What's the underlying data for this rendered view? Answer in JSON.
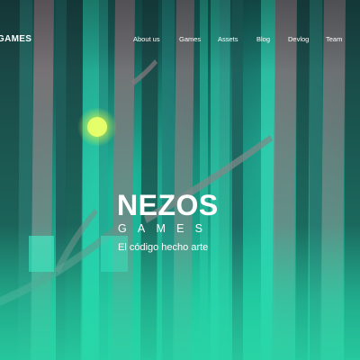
{
  "header": {
    "brand": "S GAMES",
    "nav": [
      {
        "label": "About us"
      },
      {
        "label": "Games"
      },
      {
        "label": "Assets"
      },
      {
        "label": "Blog"
      },
      {
        "label": "Devlog"
      },
      {
        "label": "Team"
      }
    ]
  },
  "hero": {
    "title": "NEZOS",
    "subtitle": "GAMES",
    "tagline": "El código hecho arte",
    "background": "forest-illustration",
    "colors": {
      "accent": "#27d3a3",
      "glow": "#d8f54a",
      "dark": "#14524f"
    }
  }
}
